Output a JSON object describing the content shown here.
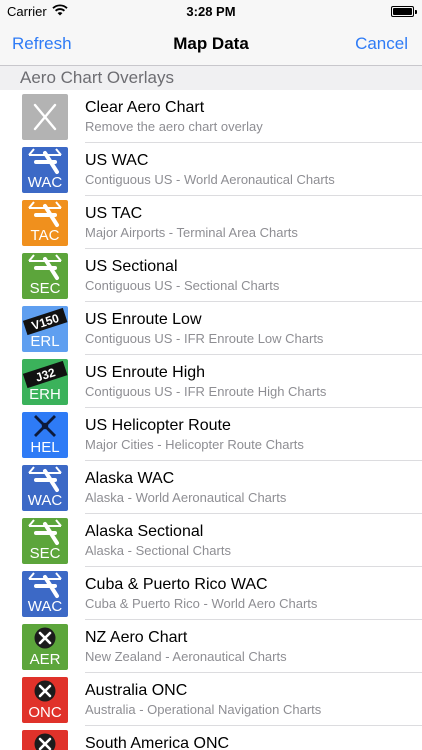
{
  "status_bar": {
    "carrier": "Carrier",
    "time": "3:28 PM"
  },
  "nav": {
    "left": "Refresh",
    "title": "Map Data",
    "right": "Cancel"
  },
  "section": {
    "title": "Aero Chart Overlays"
  },
  "colors": {
    "accent": "#2e7bf6",
    "gray": "#b3b3b3",
    "blue": "#3c69c6",
    "orange": "#f0901d",
    "green": "#5ca53b",
    "light_blue": "#5f9ff0",
    "teal_green": "#3bb25b",
    "red": "#e0322a"
  },
  "rows": [
    {
      "icon": "clear-x-icon",
      "color": "#b3b3b3",
      "code": "",
      "title": "Clear Aero Chart",
      "subtitle": "Remove the aero chart overlay"
    },
    {
      "icon": "airport-runway-icon",
      "color": "#3c69c6",
      "code": "WAC",
      "title": "US WAC",
      "subtitle": "Contiguous US - World Aeronautical Charts"
    },
    {
      "icon": "airport-runway-icon",
      "color": "#f0901d",
      "code": "TAC",
      "title": "US TAC",
      "subtitle": "Major Airports - Terminal Area Charts"
    },
    {
      "icon": "airport-runway-icon",
      "color": "#5ca53b",
      "code": "SEC",
      "title": "US Sectional",
      "subtitle": "Contiguous US - Sectional Charts"
    },
    {
      "icon": "airway-label-icon",
      "color": "#5f9ff0",
      "code": "ERL",
      "label": "V150",
      "title": "US Enroute Low",
      "subtitle": "Contiguous US - IFR Enroute Low Charts"
    },
    {
      "icon": "airway-label-icon",
      "color": "#3bb25b",
      "code": "ERH",
      "label": "J32",
      "title": "US Enroute High",
      "subtitle": "Contiguous US - IFR Enroute High Charts"
    },
    {
      "icon": "helicopter-rotor-icon",
      "color": "#2e7bf6",
      "code": "HEL",
      "title": "US Helicopter Route",
      "subtitle": "Major Cities - Helicopter Route Charts"
    },
    {
      "icon": "airport-runway-icon",
      "color": "#3c69c6",
      "code": "WAC",
      "title": "Alaska WAC",
      "subtitle": "Alaska - World Aeronautical Charts"
    },
    {
      "icon": "airport-runway-icon",
      "color": "#5ca53b",
      "code": "SEC",
      "title": "Alaska Sectional",
      "subtitle": "Alaska - Sectional Charts"
    },
    {
      "icon": "airport-runway-icon",
      "color": "#3c69c6",
      "code": "WAC",
      "title": "Cuba & Puerto Rico WAC",
      "subtitle": "Cuba & Puerto Rico - World Aero Charts"
    },
    {
      "icon": "airport-circle-icon",
      "color": "#5ca53b",
      "code": "AER",
      "title": "NZ Aero Chart",
      "subtitle": "New Zealand - Aeronautical Charts"
    },
    {
      "icon": "airport-circle-icon",
      "color": "#e0322a",
      "code": "ONC",
      "title": "Australia ONC",
      "subtitle": "Australia - Operational Navigation Charts"
    },
    {
      "icon": "airport-circle-icon",
      "color": "#e0322a",
      "code": "ONC",
      "title": "South America ONC",
      "subtitle": ""
    }
  ]
}
